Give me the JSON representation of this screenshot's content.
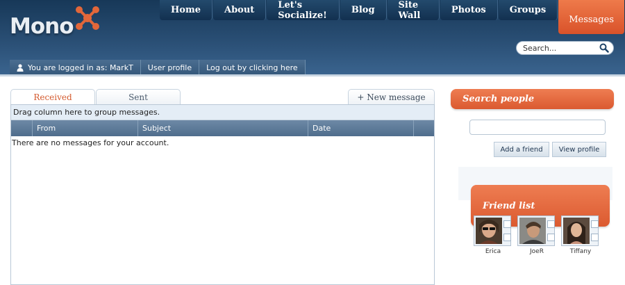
{
  "brand": {
    "logo_text": "Mono",
    "accent": "#e2673a",
    "header_bg": "#2a4f75"
  },
  "nav": {
    "items": [
      {
        "label": "Home"
      },
      {
        "label": "About"
      },
      {
        "label": "Let's Socialize!"
      },
      {
        "label": "Blog"
      },
      {
        "label": "Site Wall"
      },
      {
        "label": "Photos"
      },
      {
        "label": "Groups"
      },
      {
        "label": "Messages"
      }
    ],
    "active": "Messages"
  },
  "search": {
    "placeholder": "Search..."
  },
  "userbar": {
    "logged_in": "You are logged in as: MarkT",
    "profile": "User profile",
    "logout": "Log out by clicking here"
  },
  "messages": {
    "tabs": {
      "received": "Received",
      "sent": "Sent",
      "new_message": "+ New message"
    },
    "group_hint": "Drag column here to group messages.",
    "columns": [
      "",
      "From",
      "Subject",
      "Date",
      ""
    ],
    "empty_text": "There are no messages for your account."
  },
  "search_people": {
    "title": "Search people",
    "input_value": "",
    "add_friend": "Add a friend",
    "view_profile": "View profile"
  },
  "friend_list": {
    "title": "Friend list",
    "friends": [
      {
        "name": "Erica"
      },
      {
        "name": "JoeR"
      },
      {
        "name": "Tiffany"
      }
    ]
  }
}
